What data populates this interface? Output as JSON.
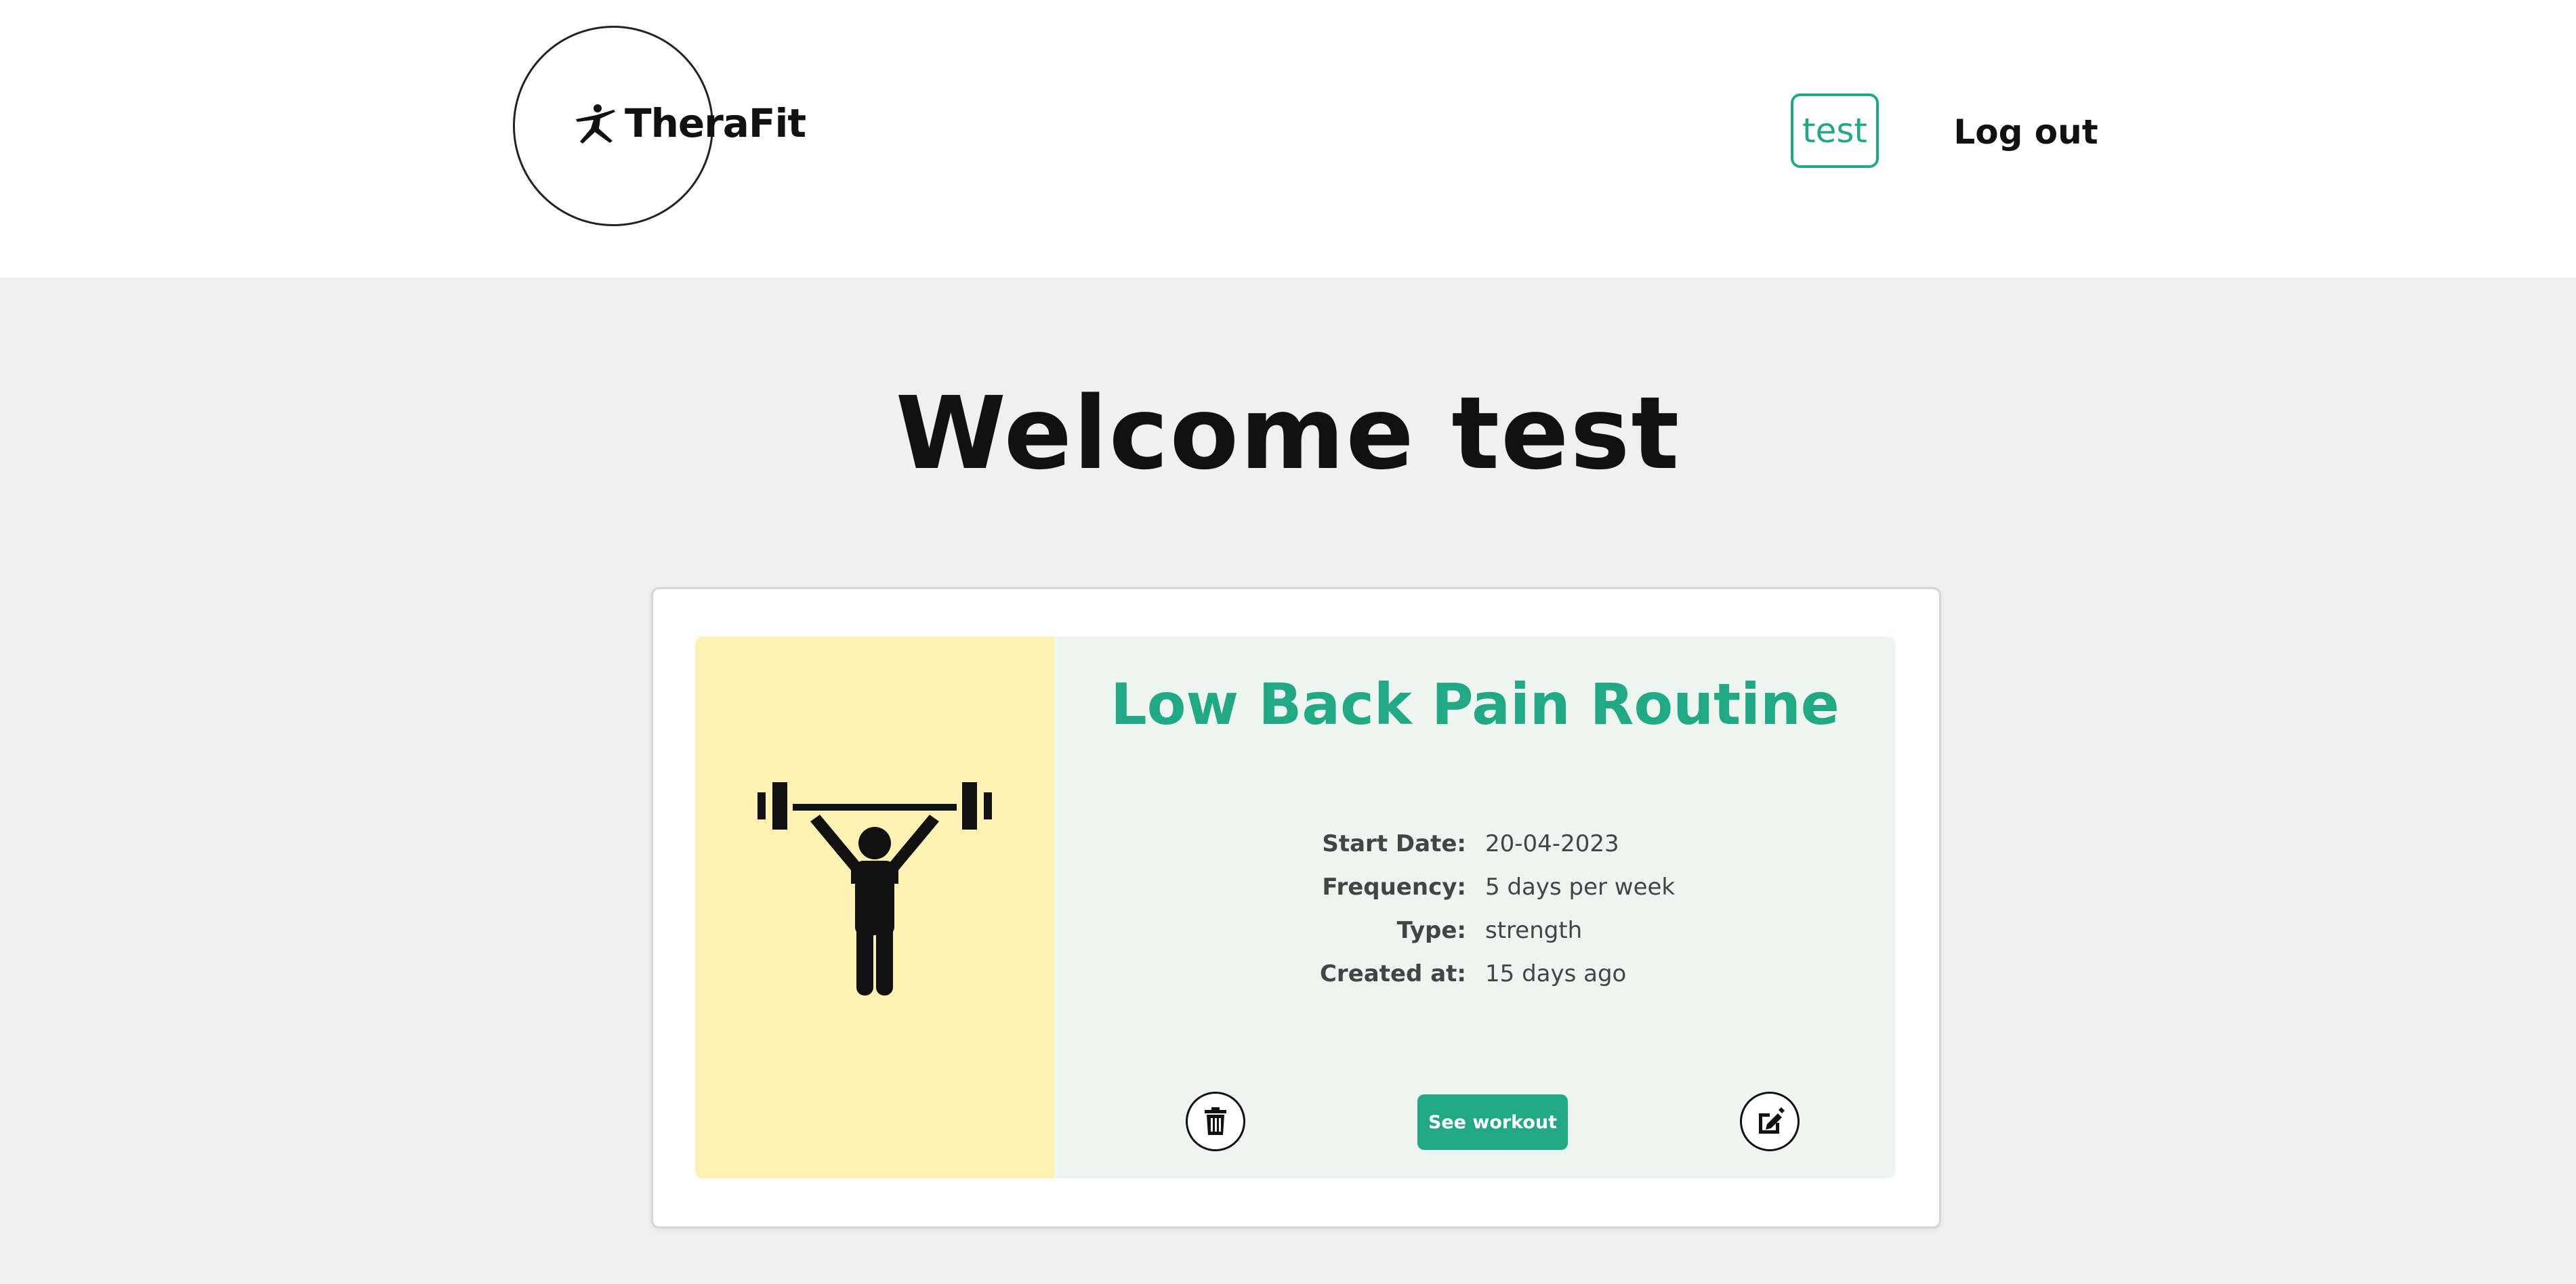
{
  "header": {
    "logo_text": "TheraFit",
    "user_badge": "test",
    "logout_label": "Log out"
  },
  "main": {
    "welcome_heading": "Welcome test"
  },
  "routine_card": {
    "title": "Low Back Pain Routine",
    "details": [
      {
        "label": "Start Date:",
        "value": "20-04-2023"
      },
      {
        "label": "Frequency:",
        "value": "5 days per week"
      },
      {
        "label": "Type:",
        "value": "strength"
      },
      {
        "label": "Created at:",
        "value": "15 days ago"
      }
    ],
    "see_workout_label": "See workout",
    "image_icon": "weightlifter-icon",
    "delete_icon": "trash-icon",
    "edit_icon": "edit-icon"
  },
  "colors": {
    "accent": "#22a884",
    "card_image_bg": "#fdf1b3",
    "card_body_bg": "#ecf5ef",
    "page_bg": "#f0f0f0"
  }
}
